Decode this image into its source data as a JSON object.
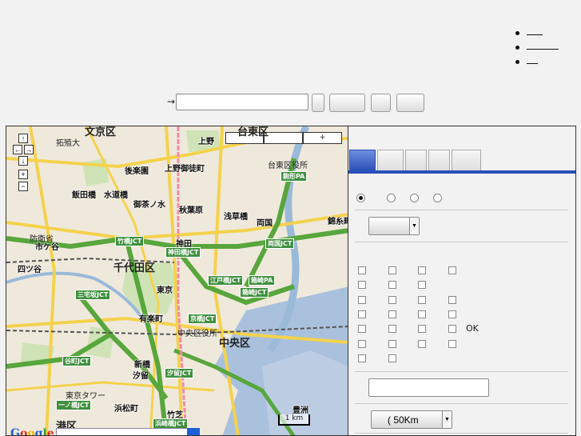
{
  "nav": {
    "items": [
      "",
      "",
      ""
    ]
  },
  "search": {
    "arrow": "→",
    "value": "",
    "placeholder": "",
    "buttons": [
      "",
      "",
      "",
      ""
    ]
  },
  "map": {
    "zoom_in": "+",
    "zoom_out": "−",
    "pan_up": "↑",
    "pan_down": "↓",
    "pan_left": "←",
    "pan_right": "→",
    "top_boxes": [
      "",
      "",
      "+"
    ],
    "scale": "1 km",
    "logo": [
      "G",
      "o",
      "o",
      "g",
      "l",
      "e"
    ],
    "labels": [
      {
        "t": "文京区",
        "c": "big"
      },
      {
        "t": "台東区",
        "c": "big"
      },
      {
        "t": "拓殖大",
        "c": ""
      },
      {
        "t": "上野",
        "c": "station"
      },
      {
        "t": "上野御徒町",
        "c": "station"
      },
      {
        "t": "後楽園",
        "c": "station"
      },
      {
        "t": "台東区役所",
        "c": ""
      },
      {
        "t": "駒形PA",
        "c": "green"
      },
      {
        "t": "飯田橋",
        "c": "station"
      },
      {
        "t": "水道橋",
        "c": "station"
      },
      {
        "t": "御茶ノ水",
        "c": "station"
      },
      {
        "t": "秋葉原",
        "c": "station"
      },
      {
        "t": "浅草橋",
        "c": "station"
      },
      {
        "t": "両国",
        "c": "station"
      },
      {
        "t": "錦糸町",
        "c": "station"
      },
      {
        "t": "防衛省",
        "c": ""
      },
      {
        "t": "市ケ谷",
        "c": "station"
      },
      {
        "t": "竹橋JCT",
        "c": "green"
      },
      {
        "t": "神田",
        "c": "station"
      },
      {
        "t": "神田橋JCT",
        "c": "green"
      },
      {
        "t": "両国JCT",
        "c": "green"
      },
      {
        "t": "四ツ谷",
        "c": "station"
      },
      {
        "t": "千代田区",
        "c": "big"
      },
      {
        "t": "江戸橋JCT",
        "c": "green"
      },
      {
        "t": "箱崎PA",
        "c": "green"
      },
      {
        "t": "東京",
        "c": "station"
      },
      {
        "t": "箱崎JCT",
        "c": "green"
      },
      {
        "t": "三宅坂JCT",
        "c": "green"
      },
      {
        "t": "有楽町",
        "c": "station"
      },
      {
        "t": "京橋JCT",
        "c": "green"
      },
      {
        "t": "中央区",
        "c": "big"
      },
      {
        "t": "谷町JCT",
        "c": "green"
      },
      {
        "t": "新橋",
        "c": "station"
      },
      {
        "t": "汐留",
        "c": "station"
      },
      {
        "t": "汐留JCT",
        "c": "green"
      },
      {
        "t": "浜松町",
        "c": "station"
      },
      {
        "t": "一ノ橋JCT",
        "c": "green"
      },
      {
        "t": "港区",
        "c": "big"
      },
      {
        "t": "浜崎橋JCT",
        "c": "green"
      },
      {
        "t": "竹芝",
        "c": "station"
      },
      {
        "t": "豊洲",
        "c": "station"
      },
      {
        "t": "中央区役所",
        "c": ""
      },
      {
        "t": "東京タワー",
        "c": ""
      },
      {
        "t": "OK",
        "c": ""
      }
    ]
  },
  "panel": {
    "tabs": [
      "",
      "",
      "",
      "",
      ""
    ],
    "radios": [
      true,
      false,
      false,
      false
    ],
    "select1": "",
    "checkbox_ok_label": "OK",
    "text_value": "",
    "distance_select": "( 50Km"
  }
}
